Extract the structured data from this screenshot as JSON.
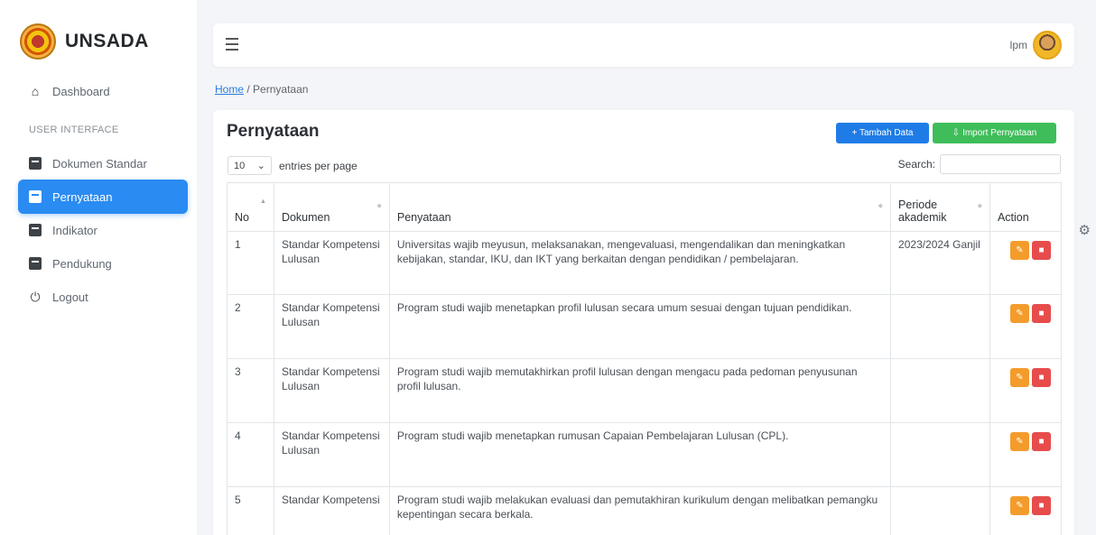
{
  "brand": {
    "name": "UNSADA"
  },
  "sidebar": {
    "dashboard": "Dashboard",
    "section_label": "USER INTERFACE",
    "items": [
      {
        "label": "Dokumen Standar",
        "icon": "book-icon",
        "active": false
      },
      {
        "label": "Pernyataan",
        "icon": "book-icon",
        "active": true
      },
      {
        "label": "Indikator",
        "icon": "book-icon",
        "active": false
      },
      {
        "label": "Pendukung",
        "icon": "book-icon",
        "active": false
      }
    ],
    "logout": "Logout"
  },
  "topbar": {
    "user": "lpm"
  },
  "breadcrumb": {
    "home": "Home",
    "separator": "/",
    "current": "Pernyataan"
  },
  "card": {
    "title": "Pernyataan",
    "add_button": "+ Tambah Data",
    "import_button": "Import Pernyataan",
    "entries_value": "10",
    "entries_label": "entries per page",
    "search_label": "Search:"
  },
  "table": {
    "headers": {
      "no": "No",
      "dokumen": "Dokumen",
      "penyataan": "Penyataan",
      "periode": "Periode akademik",
      "action": "Action"
    },
    "rows": [
      {
        "no": "1",
        "dokumen": "Standar Kompetensi Lulusan",
        "penyataan": "Universitas wajib meyusun, melaksanakan, mengevaluasi, mengendalikan dan meningkatkan kebijakan, standar, IKU, dan IKT yang berkaitan dengan pendidikan / pembelajaran.",
        "periode": "2023/2024 Ganjil"
      },
      {
        "no": "2",
        "dokumen": "Standar Kompetensi Lulusan",
        "penyataan": "Program studi wajib menetapkan profil lulusan secara umum sesuai dengan tujuan pendidikan.",
        "periode": ""
      },
      {
        "no": "3",
        "dokumen": "Standar Kompetensi Lulusan",
        "penyataan": "Program studi wajib memutakhirkan profil lulusan dengan mengacu pada pedoman penyusunan profil lulusan.",
        "periode": ""
      },
      {
        "no": "4",
        "dokumen": "Standar Kompetensi Lulusan",
        "penyataan": "Program studi wajib menetapkan rumusan Capaian Pembelajaran Lulusan (CPL).",
        "periode": ""
      },
      {
        "no": "5",
        "dokumen": "Standar Kompetensi",
        "penyataan": "Program studi wajib melakukan evaluasi dan pemutakhiran kurikulum dengan melibatkan pemangku kepentingan secara berkala.",
        "periode": ""
      }
    ]
  },
  "colors": {
    "primary": "#2a8bf2",
    "success": "#3fbd5a",
    "warning": "#f39c2c",
    "danger": "#e74c4c"
  }
}
